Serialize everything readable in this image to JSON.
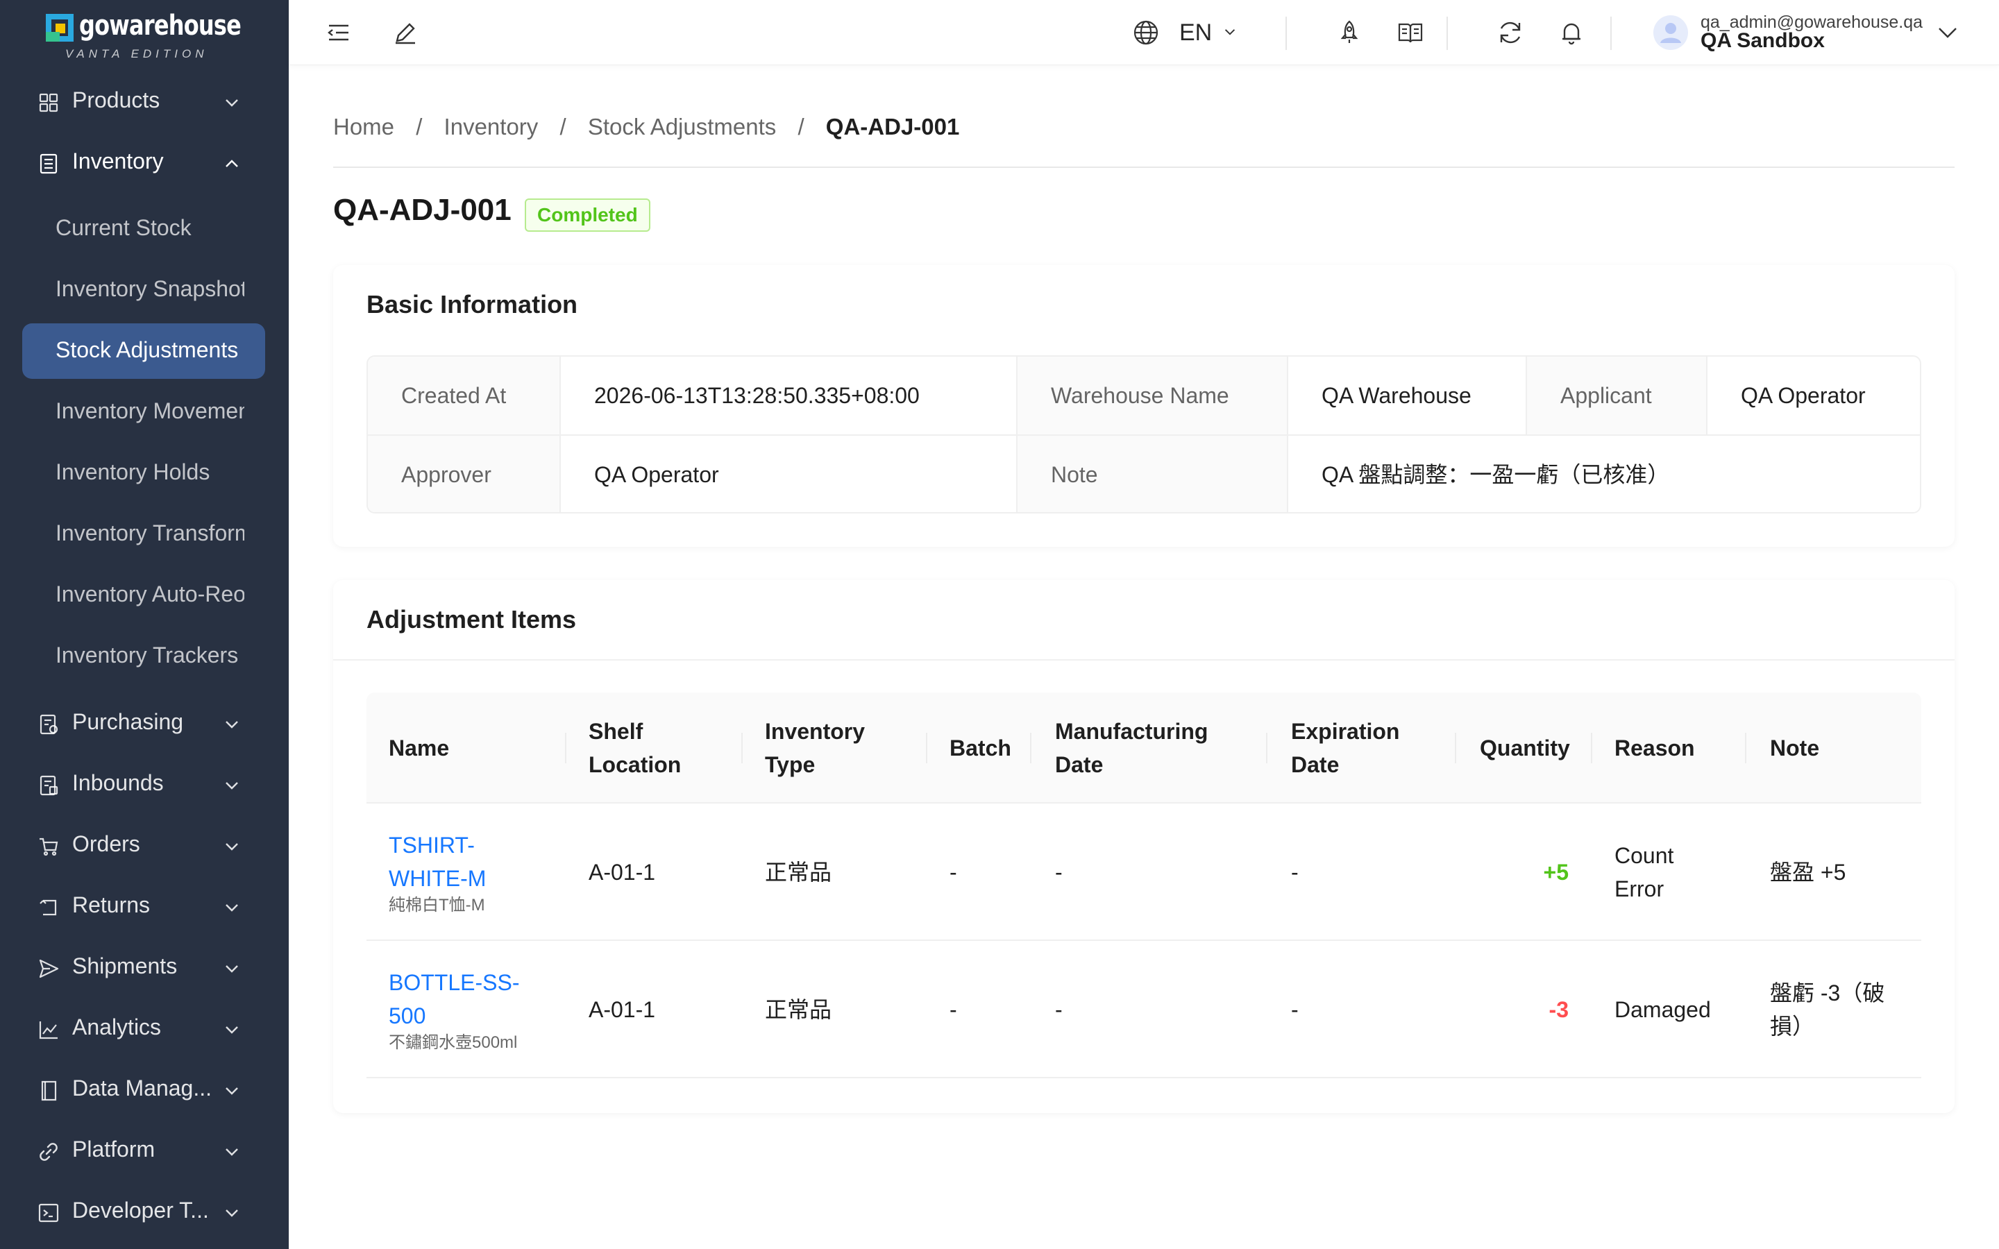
{
  "app": {
    "logo_text": "gowarehouse",
    "logo_subtitle": "VANTA EDITION"
  },
  "sidebar": {
    "menus": [
      {
        "label": "Products",
        "icon": "grid-icon"
      },
      {
        "label": "Inventory",
        "icon": "inventory-icon",
        "open": true
      },
      {
        "label": "Purchasing",
        "icon": "purchasing-icon"
      },
      {
        "label": "Inbounds",
        "icon": "inbounds-icon"
      },
      {
        "label": "Orders",
        "icon": "cart-icon"
      },
      {
        "label": "Returns",
        "icon": "returns-icon"
      },
      {
        "label": "Shipments",
        "icon": "send-icon"
      },
      {
        "label": "Analytics",
        "icon": "chart-line-icon"
      },
      {
        "label": "Data Manag...",
        "icon": "book-icon"
      },
      {
        "label": "Platform",
        "icon": "link-icon"
      },
      {
        "label": "Developer T...",
        "icon": "terminal-icon"
      }
    ],
    "inventory_items": [
      {
        "label": "Current Stock"
      },
      {
        "label": "Inventory Snapshots"
      },
      {
        "label": "Stock Adjustments",
        "active": true
      },
      {
        "label": "Inventory Movements"
      },
      {
        "label": "Inventory Holds"
      },
      {
        "label": "Inventory Transformations"
      },
      {
        "label": "Inventory Auto-Reorder"
      },
      {
        "label": "Inventory Trackers"
      }
    ]
  },
  "header": {
    "language": "EN",
    "user_email": "qa_admin@gowarehouse.qa",
    "org_name": "QA Sandbox"
  },
  "breadcrumb": {
    "items": [
      "Home",
      "Inventory",
      "Stock Adjustments"
    ],
    "current": "QA-ADJ-001",
    "separator": "/"
  },
  "page": {
    "title": "QA-ADJ-001",
    "status": "Completed",
    "status_color": "#52c41a"
  },
  "basic_info": {
    "title": "Basic Information",
    "created_at_label": "Created At",
    "created_at": "2026-06-13T13:28:50.335+08:00",
    "warehouse_label": "Warehouse Name",
    "warehouse": "QA Warehouse",
    "applicant_label": "Applicant",
    "applicant": "QA Operator",
    "approver_label": "Approver",
    "approver": "QA Operator",
    "note_label": "Note",
    "note": "QA 盤點調整：一盈一虧（已核准）"
  },
  "items": {
    "title": "Adjustment Items",
    "columns": {
      "name": "Name",
      "shelf_1": "Shelf",
      "shelf_2": "Location",
      "type_1": "Inventory",
      "type_2": "Type",
      "batch": "Batch",
      "mfg_1": "Manufacturing",
      "mfg_2": "Date",
      "exp_1": "Expiration",
      "exp_2": "Date",
      "quantity": "Quantity",
      "reason": "Reason",
      "note": "Note"
    },
    "rows": [
      {
        "sku_1": "TSHIRT-",
        "sku_2": "WHITE-M",
        "product_name": "純棉白T恤-M",
        "shelf": "A-01-1",
        "type": "正常品",
        "batch": "-",
        "mfg": "-",
        "exp": "-",
        "quantity": "+5",
        "reason_1": "Count",
        "reason_2": "Error",
        "note_1": "盤盈 +5",
        "note_2": ""
      },
      {
        "sku_1": "BOTTLE-SS-",
        "sku_2": "500",
        "product_name": "不鏽鋼水壺500ml",
        "shelf": "A-01-1",
        "type": "正常品",
        "batch": "-",
        "mfg": "-",
        "exp": "-",
        "quantity": "-3",
        "reason_1": "Damaged",
        "reason_2": "",
        "note_1": "盤虧 -3（破",
        "note_2": "損）"
      }
    ]
  },
  "colors": {
    "sidebar_bg": "#283142",
    "active_item_bg": "#3b5a8f",
    "link": "#1677ff",
    "positive": "#52c41a",
    "negative": "#ff4d4f"
  }
}
